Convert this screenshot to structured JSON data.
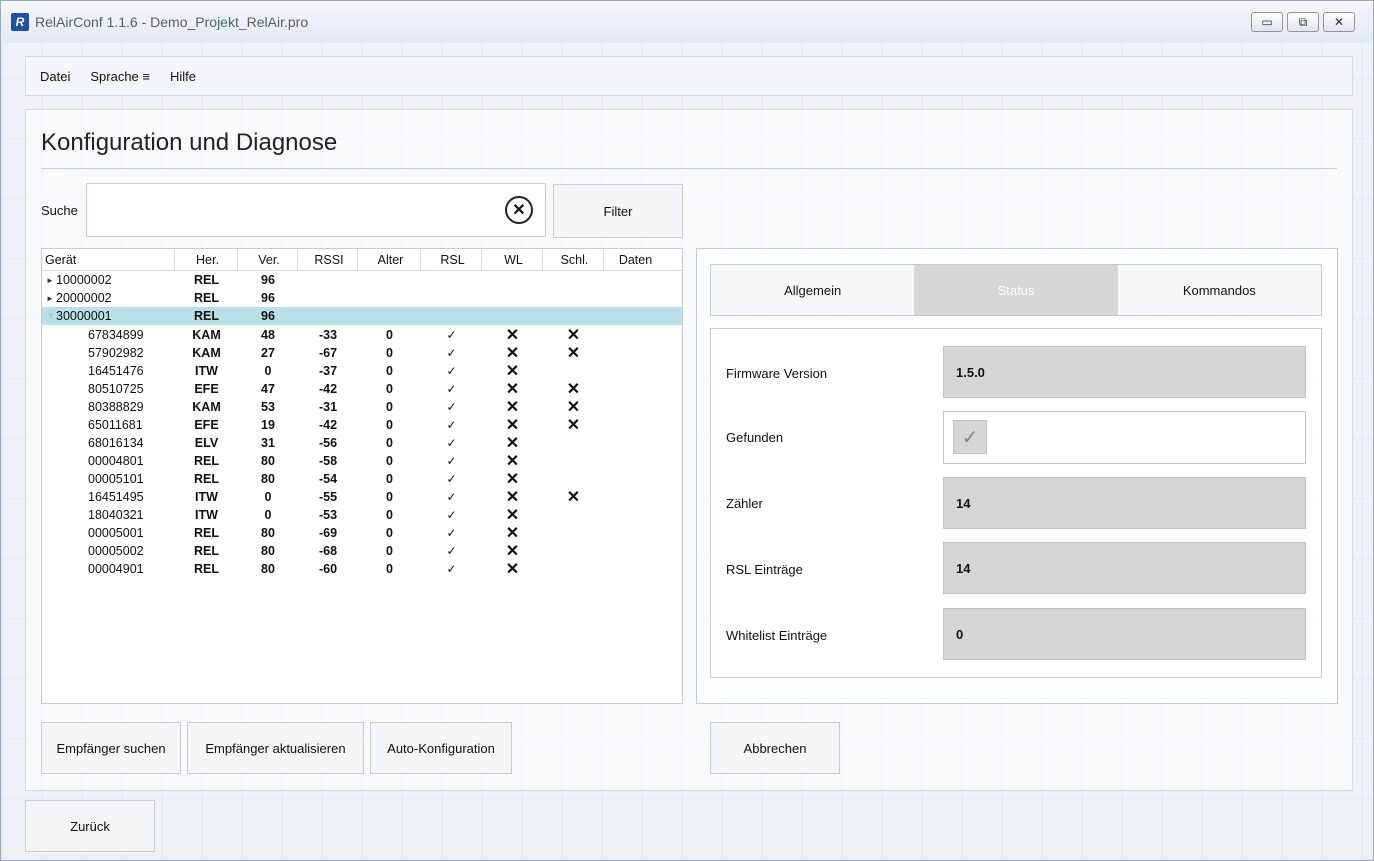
{
  "window": {
    "title": "RelAirConf 1.1.6 - Demo_Projekt_RelAir.pro",
    "minimize": "▭",
    "maximize": "⧉",
    "close": "✕"
  },
  "menu": {
    "file": "Datei",
    "language": "Sprache ≡",
    "help": "Hilfe"
  },
  "page_title": "Konfiguration und Diagnose",
  "search": {
    "label": "Suche",
    "value": "",
    "filter_label": "Filter"
  },
  "tree": {
    "columns": [
      "Gerät",
      "Her.",
      "Ver.",
      "RSSI",
      "Alter",
      "RSL",
      "WL",
      "Schl.",
      "Daten"
    ],
    "parents": [
      {
        "id": "10000002",
        "her": "REL",
        "ver": "96",
        "expanded": false
      },
      {
        "id": "20000002",
        "her": "REL",
        "ver": "96",
        "expanded": false
      },
      {
        "id": "30000001",
        "her": "REL",
        "ver": "96",
        "expanded": true
      }
    ],
    "children": [
      {
        "id": "67834899",
        "her": "KAM",
        "ver": "48",
        "rssi": "-33",
        "alter": "0",
        "rsl": "✓",
        "wl": "✕",
        "schl": "✕"
      },
      {
        "id": "57902982",
        "her": "KAM",
        "ver": "27",
        "rssi": "-67",
        "alter": "0",
        "rsl": "✓",
        "wl": "✕",
        "schl": "✕"
      },
      {
        "id": "16451476",
        "her": "ITW",
        "ver": "0",
        "rssi": "-37",
        "alter": "0",
        "rsl": "✓",
        "wl": "✕",
        "schl": ""
      },
      {
        "id": "80510725",
        "her": "EFE",
        "ver": "47",
        "rssi": "-42",
        "alter": "0",
        "rsl": "✓",
        "wl": "✕",
        "schl": "✕"
      },
      {
        "id": "80388829",
        "her": "KAM",
        "ver": "53",
        "rssi": "-31",
        "alter": "0",
        "rsl": "✓",
        "wl": "✕",
        "schl": "✕"
      },
      {
        "id": "65011681",
        "her": "EFE",
        "ver": "19",
        "rssi": "-42",
        "alter": "0",
        "rsl": "✓",
        "wl": "✕",
        "schl": "✕"
      },
      {
        "id": "68016134",
        "her": "ELV",
        "ver": "31",
        "rssi": "-56",
        "alter": "0",
        "rsl": "✓",
        "wl": "✕",
        "schl": ""
      },
      {
        "id": "00004801",
        "her": "REL",
        "ver": "80",
        "rssi": "-58",
        "alter": "0",
        "rsl": "✓",
        "wl": "✕",
        "schl": ""
      },
      {
        "id": "00005101",
        "her": "REL",
        "ver": "80",
        "rssi": "-54",
        "alter": "0",
        "rsl": "✓",
        "wl": "✕",
        "schl": ""
      },
      {
        "id": "16451495",
        "her": "ITW",
        "ver": "0",
        "rssi": "-55",
        "alter": "0",
        "rsl": "✓",
        "wl": "✕",
        "schl": "✕"
      },
      {
        "id": "18040321",
        "her": "ITW",
        "ver": "0",
        "rssi": "-53",
        "alter": "0",
        "rsl": "✓",
        "wl": "✕",
        "schl": ""
      },
      {
        "id": "00005001",
        "her": "REL",
        "ver": "80",
        "rssi": "-69",
        "alter": "0",
        "rsl": "✓",
        "wl": "✕",
        "schl": ""
      },
      {
        "id": "00005002",
        "her": "REL",
        "ver": "80",
        "rssi": "-68",
        "alter": "0",
        "rsl": "✓",
        "wl": "✕",
        "schl": ""
      },
      {
        "id": "00004901",
        "her": "REL",
        "ver": "80",
        "rssi": "-60",
        "alter": "0",
        "rsl": "✓",
        "wl": "✕",
        "schl": ""
      }
    ]
  },
  "tabs": {
    "general": "Allgemein",
    "status": "Status",
    "commands": "Kommandos"
  },
  "status": {
    "firmware_label": "Firmware Version",
    "firmware_value": "1.5.0",
    "found_label": "Gefunden",
    "found_check": "✓",
    "counter_label": "Zähler",
    "counter_value": "14",
    "rsl_label": "RSL Einträge",
    "rsl_value": "14",
    "wl_label": "Whitelist Einträge",
    "wl_value": "0"
  },
  "buttons": {
    "search_receivers": "Empfänger suchen",
    "update_receivers": "Empfänger aktualisieren",
    "auto_config": "Auto-Konfiguration",
    "cancel": "Abbrechen",
    "back": "Zurück"
  },
  "colors": {
    "selected_row": "#b9dfe8",
    "active_tab": "#d6d6d6",
    "brand": "#1f4fa8"
  }
}
